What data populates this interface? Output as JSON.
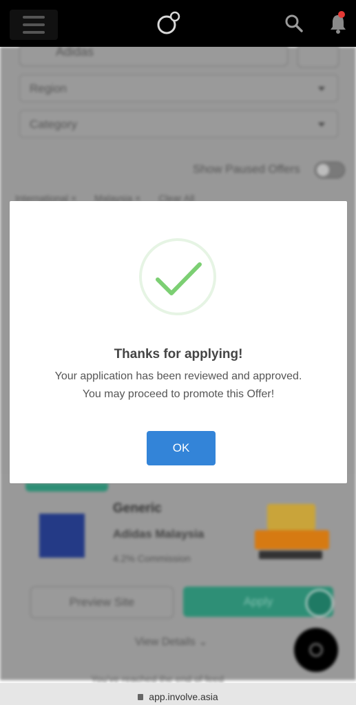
{
  "header": {
    "menu_icon": "hamburger-menu-icon",
    "logo_icon": "involve-asia-logo",
    "search_icon": "search-icon",
    "notification_icon": "bell-icon",
    "badge_color": "#e53935"
  },
  "filters": {
    "search_value": "Adidas",
    "region_placeholder": "Region",
    "category_placeholder": "Category",
    "show_paused_label": "Show Paused Offers",
    "chips": [
      "International ×",
      "Malaysia ×",
      "Clear All"
    ]
  },
  "offer_card": {
    "title": "Generic",
    "merchant": "Adidas Malaysia",
    "commission": "4.2% Commission",
    "preview_label": "Preview Site",
    "apply_label": "Apply",
    "view_details_label": "View Details ⌄",
    "accent_color": "#2e8f76"
  },
  "end_of_feed": "You've reached the end of feed",
  "browser": {
    "url": "app.involve.asia"
  },
  "modal": {
    "icon": "check-circle-icon",
    "title": "Thanks for applying!",
    "line1": "Your application has been reviewed and approved.",
    "line2": "You may proceed to promote this Offer!",
    "ok_label": "OK",
    "ok_color": "#3384d8",
    "check_color": "#7ccf73"
  }
}
